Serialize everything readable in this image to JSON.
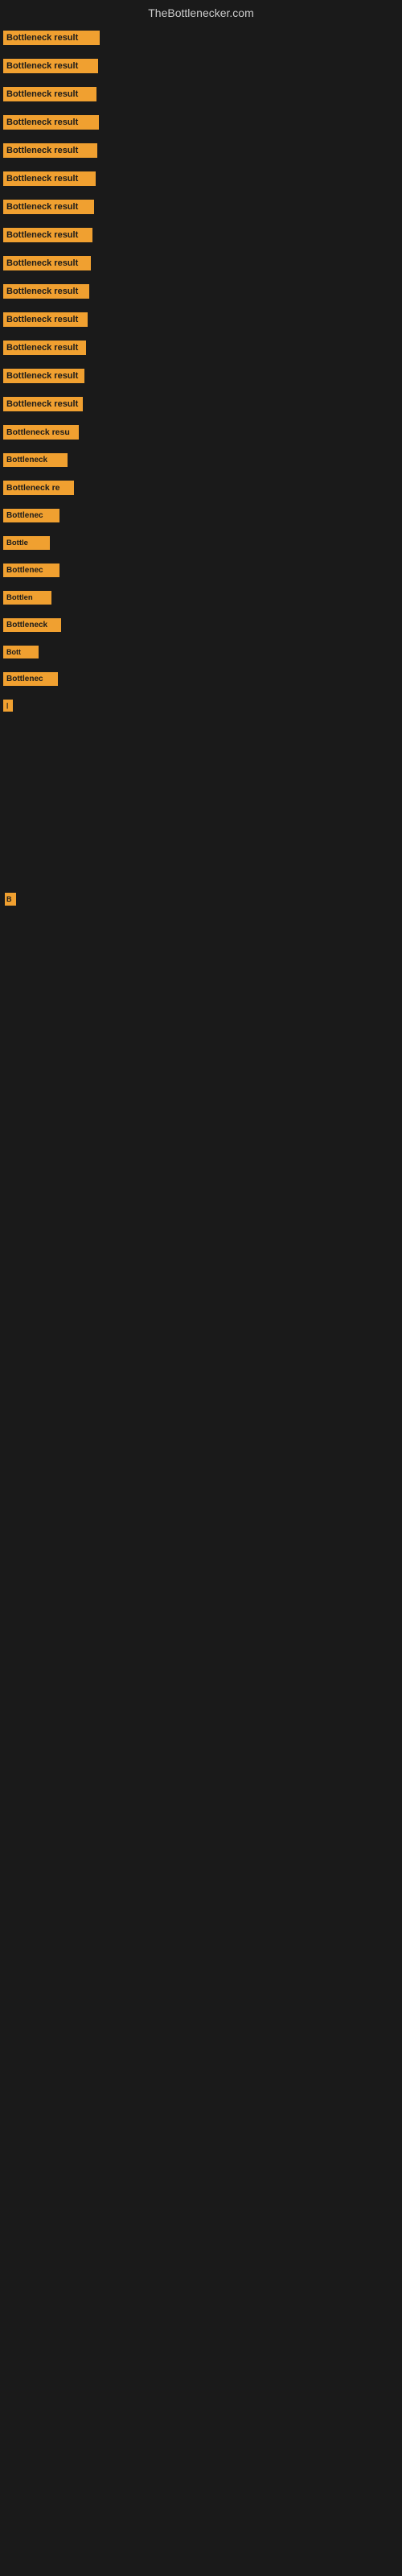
{
  "site": {
    "title": "TheBottlenecker.com"
  },
  "items": [
    {
      "id": 1,
      "label": "Bottleneck result"
    },
    {
      "id": 2,
      "label": "Bottleneck result"
    },
    {
      "id": 3,
      "label": "Bottleneck result"
    },
    {
      "id": 4,
      "label": "Bottleneck result"
    },
    {
      "id": 5,
      "label": "Bottleneck result"
    },
    {
      "id": 6,
      "label": "Bottleneck result"
    },
    {
      "id": 7,
      "label": "Bottleneck result"
    },
    {
      "id": 8,
      "label": "Bottleneck result"
    },
    {
      "id": 9,
      "label": "Bottleneck result"
    },
    {
      "id": 10,
      "label": "Bottleneck result"
    },
    {
      "id": 11,
      "label": "Bottleneck result"
    },
    {
      "id": 12,
      "label": "Bottleneck result"
    },
    {
      "id": 13,
      "label": "Bottleneck result"
    },
    {
      "id": 14,
      "label": "Bottleneck result"
    },
    {
      "id": 15,
      "label": "Bottleneck resu"
    },
    {
      "id": 16,
      "label": "Bottleneck"
    },
    {
      "id": 17,
      "label": "Bottleneck re"
    },
    {
      "id": 18,
      "label": "Bottlenec"
    },
    {
      "id": 19,
      "label": "Bottle"
    },
    {
      "id": 20,
      "label": "Bottlenec"
    },
    {
      "id": 21,
      "label": "Bottlen"
    },
    {
      "id": 22,
      "label": "Bottleneck"
    },
    {
      "id": 23,
      "label": "Bott"
    },
    {
      "id": 24,
      "label": "Bottlenec"
    },
    {
      "id": 25,
      "label": "|"
    }
  ],
  "lone_item": {
    "label": "B"
  },
  "colors": {
    "background": "#1a1a1a",
    "label_bg": "#f0a030",
    "label_text": "#1a1a1a",
    "title_text": "#cccccc"
  }
}
